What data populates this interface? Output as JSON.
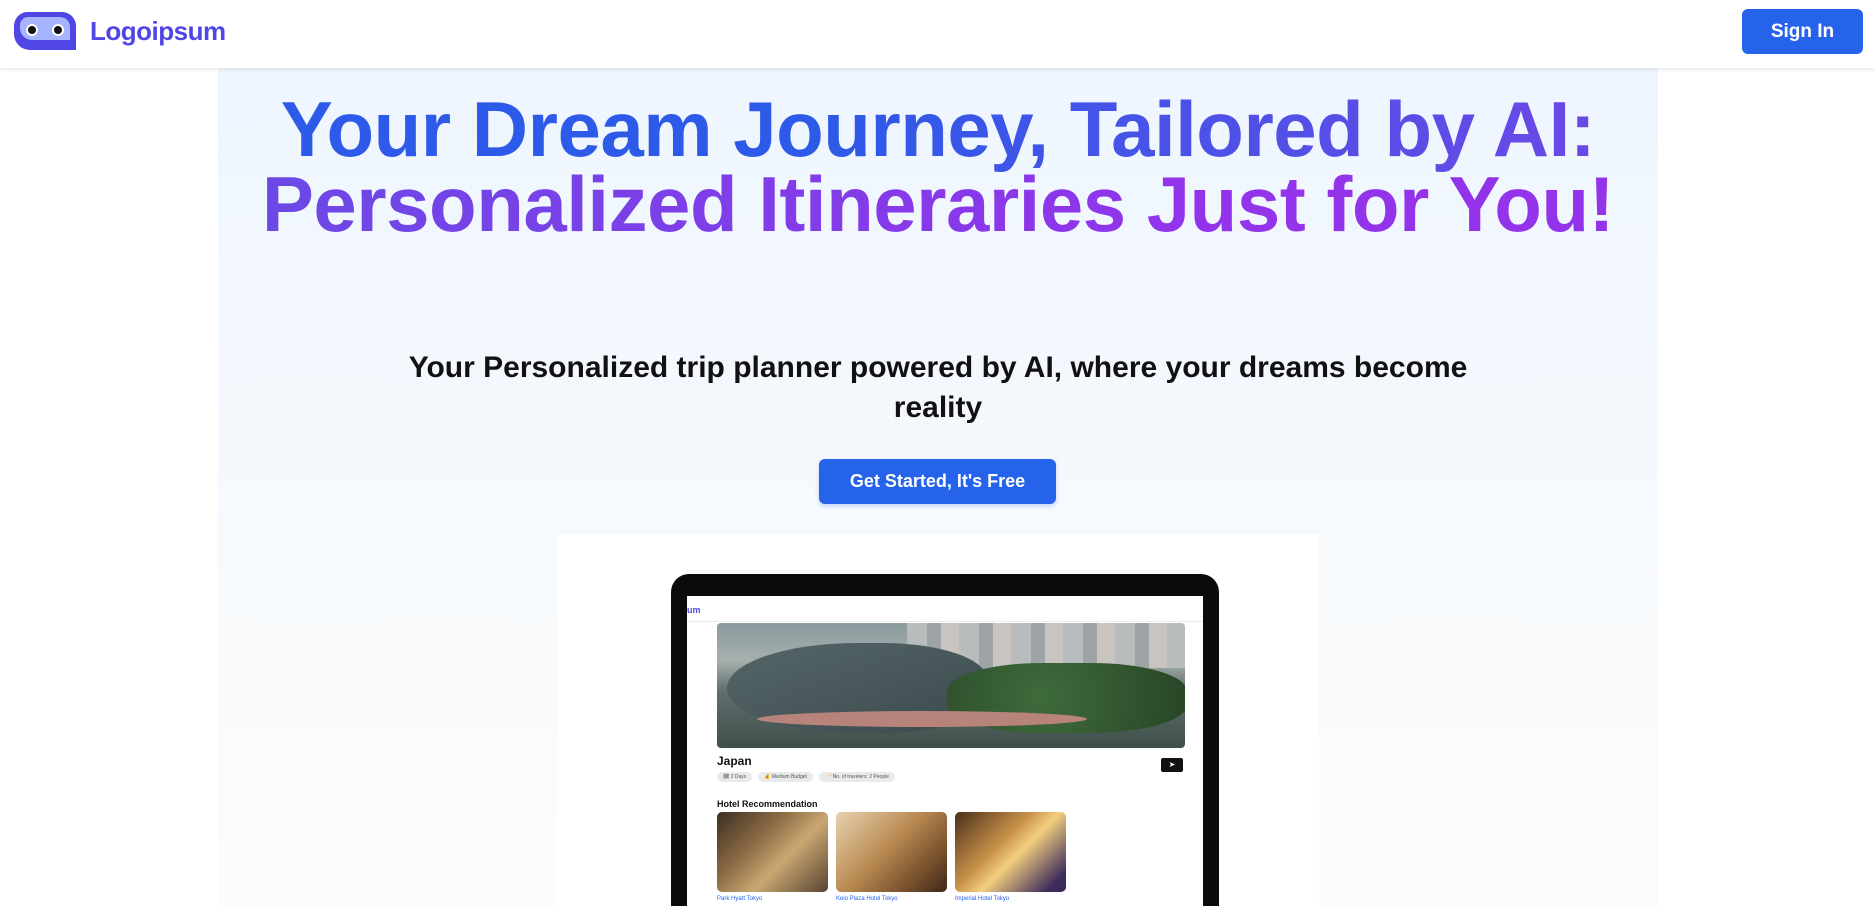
{
  "brand": {
    "name": "Logoipsum",
    "color": "#4f46e5"
  },
  "header": {
    "signin_label": "Sign In"
  },
  "hero": {
    "title": "Your Dream Journey, Tailored by AI: Personalized Itineraries Just for You!",
    "subtitle": "Your Personalized trip planner powered by AI, where your dreams become reality",
    "cta_label": "Get Started, It's Free"
  },
  "preview": {
    "logo_fragment": "um",
    "destination": "Japan",
    "chips": [
      "🗓 2 Days",
      "💰 Medium Budget",
      "🥂 No. of travelers: 2 People"
    ],
    "section_title": "Hotel Recommendation",
    "hotels": [
      {
        "name": "Park Hyatt Tokyo"
      },
      {
        "name": "Keio Plaza Hotel Tokyo"
      },
      {
        "name": "Imperial Hotel Tokyo"
      }
    ]
  },
  "colors": {
    "primary": "#2563eb",
    "gradient_start": "#2d5ae8",
    "gradient_end": "#9333ea"
  }
}
